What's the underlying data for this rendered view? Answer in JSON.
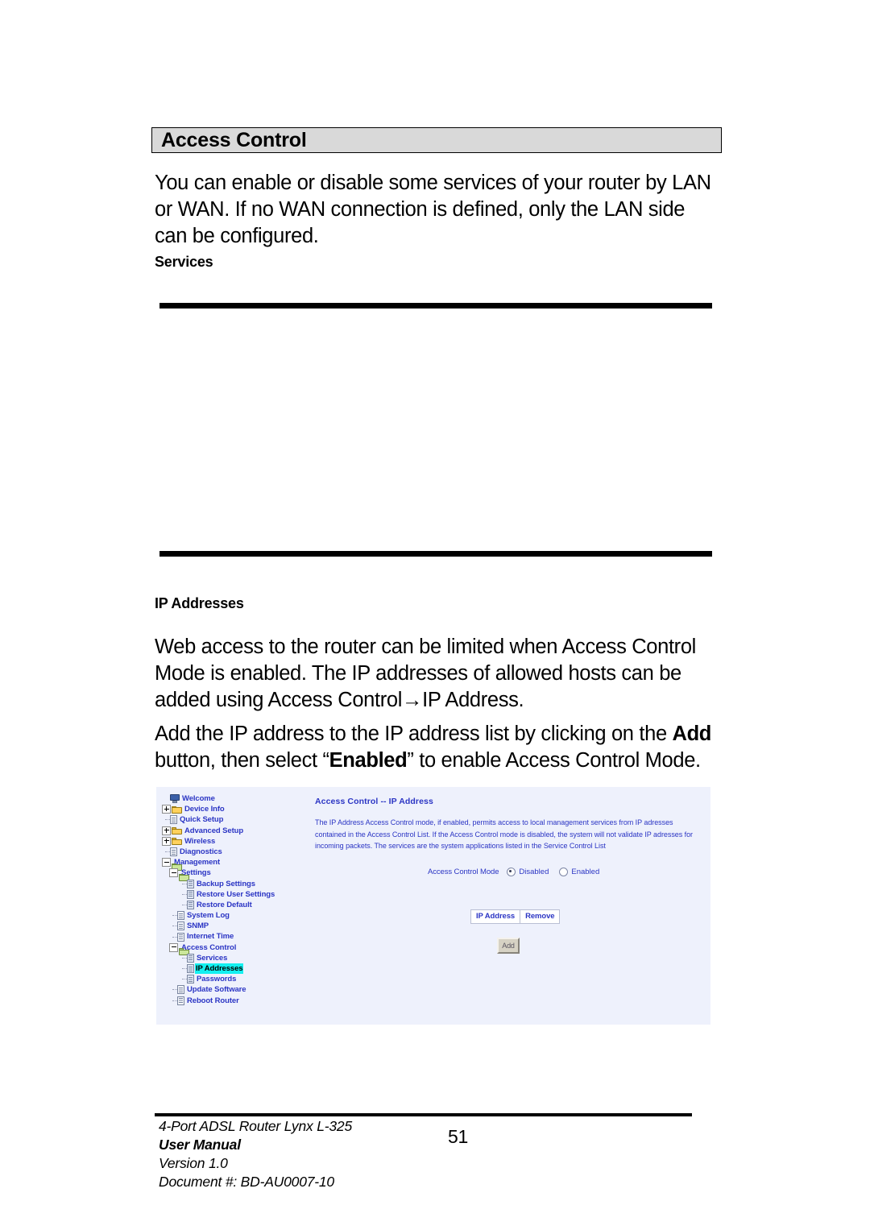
{
  "document": {
    "section_title": "Access Control",
    "intro_paragraph": "You can enable or disable some services of your router by LAN or WAN. If no WAN connection is defined, only the LAN side can be configured.",
    "subhead_services": "Services",
    "subhead_ip_addresses": "IP Addresses",
    "paragraph_2_part1": "Web access to the router can be limited when Access Control Mode is enabled. The IP addresses of allowed hosts can be added using Access Control",
    "paragraph_2_arrow": "→",
    "paragraph_2_part2": "IP Address.",
    "paragraph_3_part1": "Add the IP address to the IP address list by clicking on the ",
    "paragraph_3_bold1": "Add",
    "paragraph_3_part2": " button, then select “",
    "paragraph_3_bold2": "Enabled",
    "paragraph_3_part3": "” to enable Access Control Mode."
  },
  "footer": {
    "line1": "4-Port ADSL Router Lynx L-325",
    "line2": "User Manual",
    "line3": "Version 1.0",
    "line4": "Document #:  BD-AU0007-10",
    "page_number": "51"
  },
  "screenshot": {
    "nav_tree": [
      {
        "label": "Welcome",
        "icon": "monitor-icon",
        "expander": "none",
        "indent": 0,
        "selected": false
      },
      {
        "label": "Device Info",
        "icon": "folder-icon",
        "expander": "plus",
        "indent": 0,
        "selected": false
      },
      {
        "label": "Quick Setup",
        "icon": "page-icon",
        "expander": "leaf",
        "indent": 0,
        "selected": false
      },
      {
        "label": "Advanced Setup",
        "icon": "folder-icon",
        "expander": "plus",
        "indent": 0,
        "selected": false
      },
      {
        "label": "Wireless",
        "icon": "folder-icon",
        "expander": "plus",
        "indent": 0,
        "selected": false
      },
      {
        "label": "Diagnostics",
        "icon": "page-icon",
        "expander": "leaf",
        "indent": 0,
        "selected": false
      },
      {
        "label": "Management",
        "icon": "folder-open-icon",
        "expander": "minus",
        "indent": 0,
        "selected": false
      },
      {
        "label": "Settings",
        "icon": "folder-open-icon",
        "expander": "minus",
        "indent": 1,
        "selected": false
      },
      {
        "label": "Backup Settings",
        "icon": "page-blue-icon",
        "expander": "leaf",
        "indent": 2,
        "selected": false
      },
      {
        "label": "Restore User Settings",
        "icon": "page-blue-icon",
        "expander": "leaf",
        "indent": 2,
        "selected": false
      },
      {
        "label": "Restore Default",
        "icon": "page-blue-icon",
        "expander": "leaf",
        "indent": 2,
        "selected": false
      },
      {
        "label": "System Log",
        "icon": "page-icon",
        "expander": "leaf",
        "indent": 1,
        "selected": false
      },
      {
        "label": "SNMP",
        "icon": "page-icon",
        "expander": "leaf",
        "indent": 1,
        "selected": false
      },
      {
        "label": "Internet Time",
        "icon": "page-icon",
        "expander": "leaf",
        "indent": 1,
        "selected": false
      },
      {
        "label": "Access Control",
        "icon": "folder-open-icon",
        "expander": "minus",
        "indent": 1,
        "selected": false
      },
      {
        "label": "Services",
        "icon": "page-blue-icon",
        "expander": "leaf",
        "indent": 2,
        "selected": false
      },
      {
        "label": "IP Addresses",
        "icon": "page-blue-icon",
        "expander": "leaf",
        "indent": 2,
        "selected": true
      },
      {
        "label": "Passwords",
        "icon": "page-blue-icon",
        "expander": "leaf",
        "indent": 2,
        "selected": false
      },
      {
        "label": "Update Software",
        "icon": "page-icon",
        "expander": "leaf",
        "indent": 1,
        "selected": false
      },
      {
        "label": "Reboot Router",
        "icon": "page-icon",
        "expander": "leaf",
        "indent": 1,
        "selected": false
      }
    ],
    "pane": {
      "title": "Access Control -- IP Address",
      "description": "The IP Address Access Control mode, if enabled, permits access to local management services from IP adresses contained in the Access Control List. If the Access Control mode is disabled, the system will not validate IP adresses for incoming packets. The services are the system applications listed in the Service Control List",
      "mode_label": "Access Control Mode",
      "mode_options": [
        {
          "label": "Disabled",
          "selected": true
        },
        {
          "label": "Enabled",
          "selected": false
        }
      ],
      "table_headers": [
        "IP Address",
        "Remove"
      ],
      "table_rows": [],
      "add_button": "Add"
    },
    "colors": {
      "panel_background": "#eef1fc",
      "nav_link": "#2b35c4",
      "selection_highlight": "#14f0f0",
      "header_bar": "#d9d9d9"
    }
  }
}
